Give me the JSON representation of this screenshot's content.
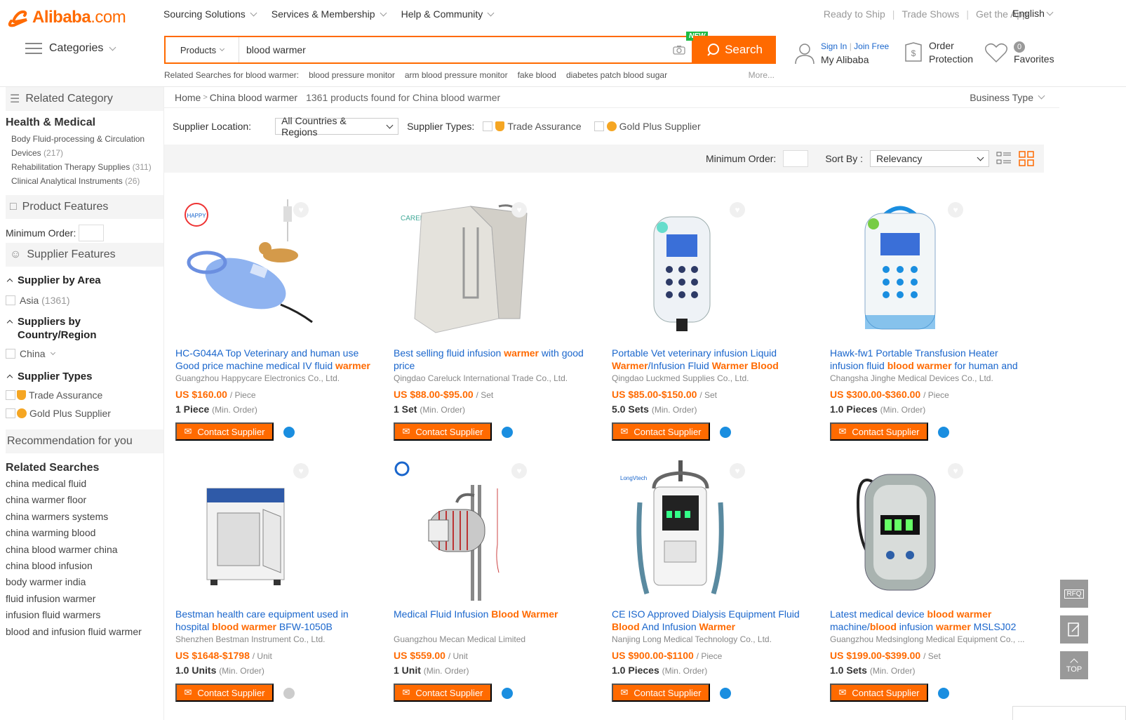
{
  "header": {
    "logo_text": "Alibaba",
    "logo_suffix": ".com",
    "nav": [
      "Sourcing Solutions",
      "Services & Membership",
      "Help & Community"
    ],
    "toplinks": [
      "Ready to Ship",
      "Trade Shows",
      "Get the App"
    ],
    "language": "English",
    "categories_label": "Categories",
    "search_type": "Products",
    "search_value": "blood warmer",
    "new_badge": "NEW",
    "search_button": "Search",
    "sign_in": "Sign In",
    "join_free": "Join Free",
    "my_alibaba": "My Alibaba",
    "order_line1": "Order",
    "order_line2": "Protection",
    "fav_count": "0",
    "favorites": "Favorites",
    "related_label": "Related Searches for blood warmer:",
    "related": [
      "blood pressure monitor",
      "arm blood pressure monitor",
      "fake blood",
      "diabetes patch blood sugar"
    ],
    "related_more": "More..."
  },
  "sidebar": {
    "related_category": "Related Category",
    "health_title": "Health & Medical",
    "sub1_a": "Body Fluid-processing & Circulation",
    "sub1_b": "Devices",
    "sub1_cnt": "(217)",
    "sub2": "Rehabilitation Therapy Supplies",
    "sub2_cnt": "(311)",
    "sub3": "Clinical Analytical Instruments",
    "sub3_cnt": "(26)",
    "product_features": "Product Features",
    "min_order": "Minimum Order:",
    "supplier_features": "Supplier Features",
    "by_area": "Supplier by Area",
    "asia": "Asia",
    "asia_cnt": "(1361)",
    "by_country_1": "Suppliers by",
    "by_country_2": "Country/Region",
    "china": "China",
    "supplier_types": "Supplier Types",
    "trade_assurance": "Trade Assurance",
    "gold_plus": "Gold Plus Supplier",
    "recommendation": "Recommendation for you",
    "related_searches_title": "Related Searches",
    "links": [
      "china medical fluid",
      "china warmer floor",
      "china warmers systems",
      "china warming blood",
      "china blood warmer china",
      "china blood infusion",
      "body warmer india",
      "fluid infusion warmer",
      "infusion fluid warmers",
      "blood and infusion fluid warmer"
    ]
  },
  "main": {
    "home": "Home",
    "crumb": "China blood warmer",
    "found": "1361 products found for China blood warmer",
    "business_type": "Business Type",
    "supplier_location": "Supplier Location:",
    "region": "All Countries & Regions",
    "supplier_types": "Supplier Types:",
    "trade_assurance": "Trade Assurance",
    "gold_plus": "Gold Plus Supplier",
    "minimum_order": "Minimum Order:",
    "sort_by": "Sort By :",
    "sort_value": "Relevancy",
    "contact": "Contact Supplier"
  },
  "products": [
    {
      "t1": "HC-G044A Top Veterinary and human use Good price machine medical IV fluid ",
      "t2": "warmer",
      "t3": "",
      "company": "Guangzhou Happycare Electronics Co., Ltd.",
      "price": "US $160.00",
      "unit": "/ Piece",
      "moq": "1 Piece",
      "mo": "(Min. Order)"
    },
    {
      "t1": "Best selling fluid infusion ",
      "t2": "warmer",
      "t3": " with good price",
      "company": "Qingdao Careluck International Trade Co., Ltd.",
      "price": "US $88.00-$95.00",
      "unit": "/ Set",
      "moq": "1 Set",
      "mo": "(Min. Order)"
    },
    {
      "t1": "Portable Vet veterinary infusion Liquid ",
      "t2": "Warmer",
      "t3": "/Infusion Fluid ",
      "t4": "Warmer Blood",
      "company": "Qingdao Luckmed Supplies Co., Ltd.",
      "price": "US $85.00-$150.00",
      "unit": "/ Set",
      "moq": "5.0 Sets",
      "mo": "(Min. Order)"
    },
    {
      "t1": "Hawk-fw1 Portable Transfusion Heater infusion fluid ",
      "t2": "blood warmer",
      "t3": " for human and",
      "company": "Changsha Jinghe Medical Devices Co., Ltd.",
      "price": "US $300.00-$360.00",
      "unit": "/ Piece",
      "moq": "1.0 Pieces",
      "mo": "(Min. Order)"
    },
    {
      "t1": "Bestman health care equipment used in hospital ",
      "t2": "blood warmer",
      "t3": " BFW-1050B",
      "company": "Shenzhen Bestman Instrument Co., Ltd.",
      "price": "US $1648-$1798",
      "unit": "/ Unit",
      "moq": "1.0 Units",
      "mo": "(Min. Order)"
    },
    {
      "t1": "Medical Fluid Infusion ",
      "t2": "Blood Warmer",
      "t3": "",
      "company": "Guangzhou Mecan Medical Limited",
      "price": "US $559.00",
      "unit": "/ Unit",
      "moq": "1 Unit",
      "mo": "(Min. Order)"
    },
    {
      "t1": "CE ISO Approved Dialysis Equipment Fluid ",
      "t2": "Blood",
      "t3": " And Infusion ",
      "t4": "Warmer",
      "company": "Nanjing Long Medical Technology Co., Ltd.",
      "price": "US $900.00-$1100",
      "unit": "/ Piece",
      "moq": "1.0 Pieces",
      "mo": "(Min. Order)"
    },
    {
      "t1": "Latest medical device ",
      "t2": "blood warmer",
      "t3": " machine/",
      "t4": "blood",
      "t5": " infusion ",
      "t6": "warmer",
      "t7": " MSLSJ02",
      "company": "Guangzhou Medsinglong Medical Equipment Co., ...",
      "price": "US $199.00-$399.00",
      "unit": "/ Set",
      "moq": "1.0 Sets",
      "mo": "(Min. Order)"
    }
  ],
  "float": {
    "rfq": "RFQ",
    "top": "TOP"
  },
  "colors": {
    "accent": "#ff6a00",
    "link": "#1a66cc",
    "new_badge": "#1dbb44"
  }
}
